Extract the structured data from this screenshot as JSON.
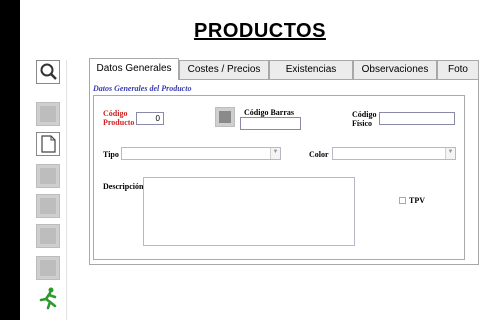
{
  "window": {
    "title": "PRODUCTOS"
  },
  "toolbar": {
    "buttons": [
      {
        "name": "search-icon"
      },
      {
        "name": "disabled-icon"
      },
      {
        "name": "new-document-icon"
      },
      {
        "name": "disabled-icon"
      },
      {
        "name": "disabled-icon"
      },
      {
        "name": "disabled-icon"
      },
      {
        "name": "disabled-icon"
      },
      {
        "name": "exit-runner-icon"
      }
    ]
  },
  "tabs": [
    {
      "label": "Datos Generales",
      "active": true
    },
    {
      "label": "Costes / Precios",
      "active": false
    },
    {
      "label": "Existencias",
      "active": false
    },
    {
      "label": "Observaciones",
      "active": false
    },
    {
      "label": "Foto",
      "active": false
    }
  ],
  "section_title": "Datos Generales del Producto",
  "form": {
    "codigo_producto_label_line1": "Código",
    "codigo_producto_label_line2": "Producto",
    "codigo_producto_value": "0",
    "codigo_barras_label": "Código Barras",
    "codigo_barras_value": "",
    "codigo_fisico_label_line1": "Código",
    "codigo_fisico_label_line2": "Físico",
    "codigo_fisico_value": "",
    "tipo_label": "Tipo",
    "tipo_value": "",
    "color_label": "Color",
    "color_value": "",
    "descripcion_label": "Descripción",
    "descripcion_value": "",
    "tpv_label": "TPV",
    "tpv_checked": false
  },
  "colors": {
    "required_label": "#cc2222",
    "section_title": "#3a3ab0",
    "exit_icon": "#2e9a2e"
  }
}
